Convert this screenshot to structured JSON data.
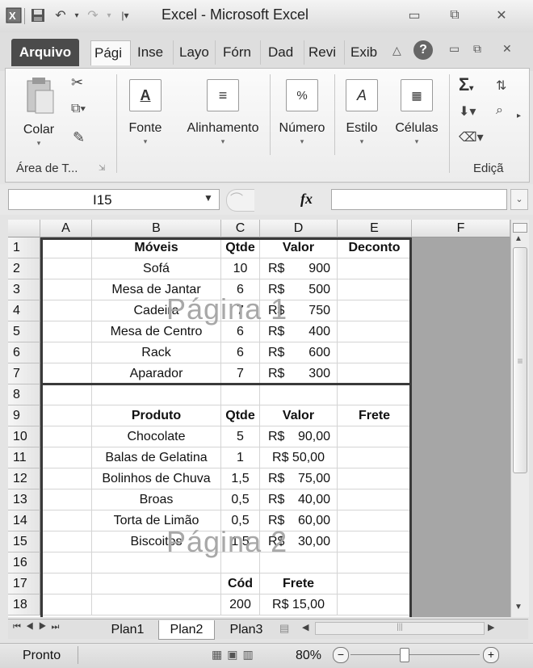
{
  "window": {
    "title": "Excel - Microsoft Excel"
  },
  "ribbon_tabs": [
    "Arquivo",
    "Pági",
    "Inse",
    "Layo",
    "Fórn",
    "Dad",
    "Revi",
    "Exib"
  ],
  "ribbon": {
    "paste_label": "Colar",
    "clipboard_group": "Área de T...",
    "font_label": "Fonte",
    "alignment_label": "Alinhamento",
    "number_label": "Número",
    "style_label": "Estilo",
    "cells_label": "Células",
    "editing_group": "Ediçã"
  },
  "formula_bar": {
    "name_box": "I15",
    "fx": "fx",
    "formula": ""
  },
  "columns": [
    "A",
    "B",
    "C",
    "D",
    "E",
    "F"
  ],
  "rows": [
    {
      "n": "1",
      "b": "Móveis",
      "c": "Qtde",
      "d1": "Valor",
      "d2": "",
      "e": "Deconto",
      "bold": true
    },
    {
      "n": "2",
      "b": "Sofá",
      "c": "10",
      "d1": "R$",
      "d2": "900",
      "e": ""
    },
    {
      "n": "3",
      "b": "Mesa de Jantar",
      "c": "6",
      "d1": "R$",
      "d2": "500",
      "e": ""
    },
    {
      "n": "4",
      "b": "Cadeira",
      "c": "7",
      "d1": "R$",
      "d2": "750",
      "e": ""
    },
    {
      "n": "5",
      "b": "Mesa de Centro",
      "c": "6",
      "d1": "R$",
      "d2": "400",
      "e": ""
    },
    {
      "n": "6",
      "b": "Rack",
      "c": "6",
      "d1": "R$",
      "d2": "600",
      "e": ""
    },
    {
      "n": "7",
      "b": "Aparador",
      "c": "7",
      "d1": "R$",
      "d2": "300",
      "e": ""
    },
    {
      "n": "8",
      "b": "",
      "c": "",
      "d1": "",
      "d2": "",
      "e": ""
    },
    {
      "n": "9",
      "b": "Produto",
      "c": "Qtde",
      "d1": "Valor",
      "d2": "",
      "e": "Frete",
      "bold": true
    },
    {
      "n": "10",
      "b": "Chocolate",
      "c": "5",
      "d1": "R$",
      "d2": "90,00",
      "e": ""
    },
    {
      "n": "11",
      "b": "Balas de Gelatina",
      "c": "1",
      "d1": "R$ 50,00",
      "d2": "",
      "e": ""
    },
    {
      "n": "12",
      "b": "Bolinhos de Chuva",
      "c": "1,5",
      "d1": "R$",
      "d2": "75,00",
      "e": ""
    },
    {
      "n": "13",
      "b": "Broas",
      "c": "0,5",
      "d1": "R$",
      "d2": "40,00",
      "e": ""
    },
    {
      "n": "14",
      "b": "Torta de Limão",
      "c": "0,5",
      "d1": "R$",
      "d2": "60,00",
      "e": ""
    },
    {
      "n": "15",
      "b": "Biscoitos",
      "c": "1,5",
      "d1": "R$",
      "d2": "30,00",
      "e": ""
    },
    {
      "n": "16",
      "b": "",
      "c": "",
      "d1": "",
      "d2": "",
      "e": ""
    },
    {
      "n": "17",
      "b": "",
      "c": "Cód",
      "d1": "Frete",
      "d2": "",
      "e": "",
      "bold": true
    },
    {
      "n": "18",
      "b": "",
      "c": "200",
      "d1": "R$ 15,00",
      "d2": "",
      "e": ""
    }
  ],
  "watermarks": {
    "page1": "Página 1",
    "page2": "Página 2"
  },
  "sheet_tabs": [
    "Plan1",
    "Plan2",
    "Plan3"
  ],
  "active_sheet": "Plan2",
  "status": {
    "text": "Pronto",
    "zoom": "80%"
  }
}
